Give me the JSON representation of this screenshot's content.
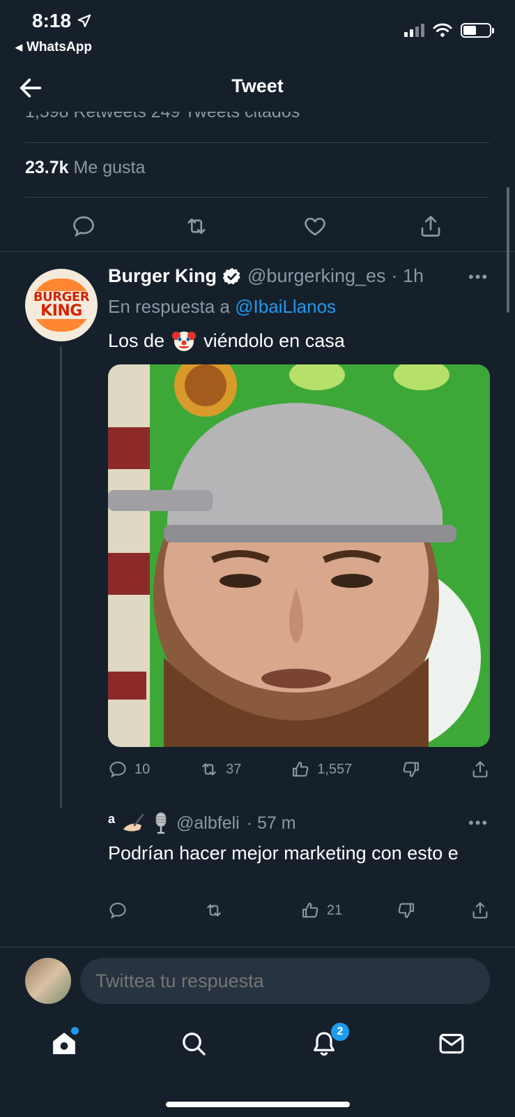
{
  "status_bar": {
    "time": "8:18",
    "back_app": "WhatsApp"
  },
  "header": {
    "title": "Tweet"
  },
  "stats": {
    "cut_text": "1,598 Retweets  249 Tweets citados",
    "likes_count": "23.7k",
    "likes_label": "Me gusta"
  },
  "reply1": {
    "author_name": "Burger King",
    "handle": "@burgerking_es",
    "time": "· 1h",
    "reply_prefix": "En respuesta a",
    "reply_to": "@IbaiLlanos",
    "text_before": "Los de",
    "text_after": "viéndolo en casa",
    "avatar_text_1": "BURGER",
    "avatar_text_2": "KING",
    "replies": "10",
    "retweets": "37",
    "likes": "1,557"
  },
  "reply2": {
    "name_letter": "a",
    "handle": "@albfeli",
    "time": "· 57 m",
    "text": "Podrían hacer mejor marketing con esto e",
    "likes": "21"
  },
  "compose": {
    "placeholder": "Twittea tu respuesta"
  },
  "tabbar": {
    "notifications_badge": "2"
  },
  "colors": {
    "background": "#15202b",
    "accent": "#1d9bf0",
    "muted": "#8b98a5",
    "divider": "#38444d"
  },
  "icons": [
    "back-arrow-icon",
    "reply-icon",
    "retweet-icon",
    "like-icon",
    "share-icon",
    "verified-icon",
    "more-icon",
    "dislike-icon",
    "home-icon",
    "search-icon",
    "notifications-icon",
    "messages-icon"
  ]
}
